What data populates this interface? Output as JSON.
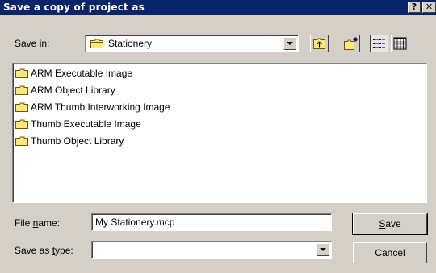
{
  "window": {
    "title": "Save a copy of project as",
    "help_label": "?",
    "close_label": "✕"
  },
  "save_in": {
    "label_pre": "Save ",
    "label_ul": "i",
    "label_post": "n:",
    "value": "Stationery"
  },
  "toolbar": {
    "icons": [
      "up-one-level-icon",
      "new-folder-icon",
      "list-view-icon",
      "details-view-icon"
    ]
  },
  "files": [
    "ARM Executable Image",
    "ARM Object Library",
    "ARM Thumb Interworking Image",
    "Thumb Executable Image",
    "Thumb Object Library"
  ],
  "file_name": {
    "label_pre": "File ",
    "label_ul": "n",
    "label_post": "ame:",
    "value": "My Stationery.mcp"
  },
  "save_as_type": {
    "label_pre": "Save as ",
    "label_ul": "t",
    "label_post": "ype:",
    "value": ""
  },
  "buttons": {
    "save_ul": "S",
    "save_rest": "ave",
    "cancel": "Cancel"
  },
  "colors": {
    "titlebar": "#0a246a",
    "face": "#d4d0c8",
    "folder": "#ffe680"
  }
}
